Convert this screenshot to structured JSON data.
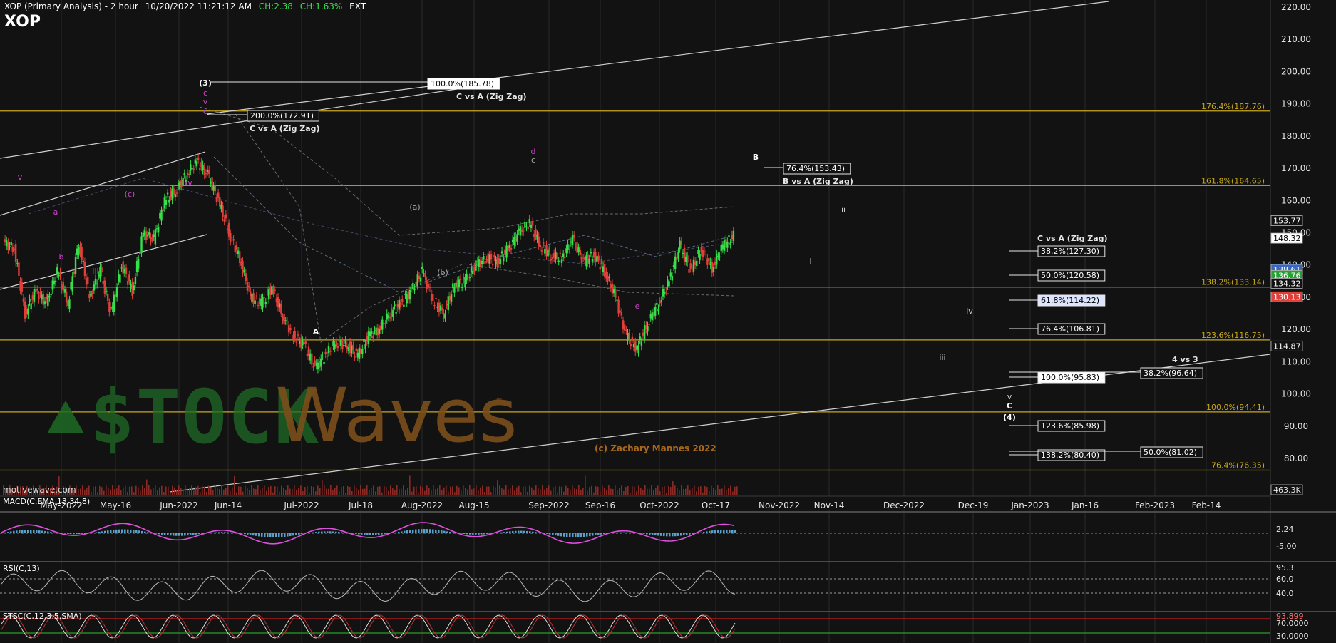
{
  "header": {
    "title": "XOP (Primary Analysis) - 2 hour",
    "datetime": "10/20/2022 11:21:12 AM",
    "ch1": "CH:2.38",
    "ch2": "CH:1.63%",
    "session": "EXT",
    "symbol": "XOP"
  },
  "watermark": {
    "site": "motivewave.com",
    "credit": "(c) Zachary Mannes 2022",
    "logo_a": "$TOCK",
    "logo_b": "Waves",
    "tm": "™"
  },
  "colors": {
    "bg": "#121212",
    "up": "#35e04a",
    "down": "#e0403a",
    "fib": "#c8a81a",
    "wave": "#cc44cc",
    "macd_line": "#e050e0",
    "macd_hist": "#5aa0c8"
  },
  "chart_data": {
    "type": "line",
    "price_axis": {
      "ylim": [
        72,
        222
      ],
      "ticks": [
        80,
        90,
        100,
        110,
        120,
        130,
        140,
        150,
        160,
        170,
        180,
        190,
        200,
        210,
        220
      ]
    },
    "time_axis": {
      "labels": [
        "May-2022",
        "May-16",
        "Jun-2022",
        "Jun-14",
        "Jul-2022",
        "Jul-18",
        "Aug-2022",
        "Aug-15",
        "Sep-2022",
        "Sep-16",
        "Oct-2022",
        "Oct-17",
        "Nov-2022",
        "Nov-14",
        "Dec-2022",
        "Dec-19",
        "Jan-2023",
        "Jan-16",
        "Feb-2023",
        "Feb-14"
      ]
    },
    "price_series": {
      "name": "XOP",
      "values": [
        147,
        145,
        125,
        132,
        128,
        138,
        128,
        147,
        130,
        138,
        125,
        140,
        132,
        150,
        148,
        160,
        163,
        168,
        172,
        168,
        160,
        150,
        142,
        130,
        128,
        133,
        124,
        118,
        115,
        108,
        112,
        116,
        115,
        112,
        118,
        120,
        125,
        128,
        132,
        138,
        129,
        125,
        134,
        135,
        140,
        142,
        141,
        145,
        150,
        153,
        146,
        143,
        142,
        148,
        141,
        143,
        138,
        130,
        118,
        114,
        122,
        128,
        135,
        146,
        138,
        145,
        139,
        146,
        149
      ]
    },
    "fib_lines": [
      {
        "price": 187.76,
        "label": "176.4%(187.76)"
      },
      {
        "price": 164.65,
        "label": "161.8%(164.65)"
      },
      {
        "price": 133.14,
        "label": "138.2%(133.14)"
      },
      {
        "price": 116.75,
        "label": "123.6%(116.75)"
      },
      {
        "price": 94.41,
        "label": "100.0%(94.41)"
      },
      {
        "price": 76.35,
        "label": "76.4%(76.35)"
      }
    ],
    "right_axis_tags": [
      {
        "price": 153.77,
        "label": "153.77",
        "bg": "#121212"
      },
      {
        "price": 148.32,
        "label": "148.32",
        "bg": "#ffffff"
      },
      {
        "price": 138.61,
        "label": "138.61",
        "bg": "#3a66c0"
      },
      {
        "price": 136.76,
        "label": "136.76",
        "bg": "#25a032"
      },
      {
        "price": 134.32,
        "label": "134.32",
        "bg": "#121212"
      },
      {
        "price": 130.13,
        "label": "130.13",
        "bg": "#e0403a"
      },
      {
        "price": 114.87,
        "label": "114.87",
        "bg": "#121212"
      }
    ],
    "volume_tag": "463.3K",
    "annotations": {
      "target_c_top": {
        "pct": "100.0%(185.78)",
        "text": "C vs A (Zig Zag)"
      },
      "target_c_mid": {
        "pct": "200.0%(172.91)",
        "text": "C vs A (Zig Zag)"
      },
      "target_b": {
        "pct": "76.4%(153.43)",
        "text": "B vs A (Zig Zag)"
      },
      "c_vs_a_title": "C vs A (Zig Zag)",
      "c_vs_a_levels": [
        "38.2%(127.30)",
        "50.0%(120.58)",
        "61.8%(114.22)",
        "76.4%(106.81)",
        "100.0%(95.83)",
        "123.6%(85.98)",
        "138.2%(80.40)"
      ],
      "four_vs_three_title": "4 vs 3",
      "four_vs_three_levels": [
        "38.2%(96.64)",
        "50.0%(81.02)"
      ]
    },
    "wave_labels": [
      "(3)",
      "c",
      "v",
      "c",
      "A",
      "B",
      "c",
      "(a)",
      "(b)",
      "(c)",
      "d",
      "e",
      "i",
      "ii",
      "iii",
      "iv",
      "v",
      "C",
      "(4)",
      "a",
      "b",
      "iii",
      "iv",
      "v"
    ],
    "macd": {
      "label": "MACD(C,EMA,13,34,8)",
      "ticks": [
        "2.24",
        "-5.00"
      ]
    },
    "rsi": {
      "label": "RSI(C,13)",
      "ticks": [
        "95.3",
        "60.0",
        "40.0"
      ]
    },
    "stoch": {
      "label": "STSC(C,12,3,5,SMA)",
      "ticks": [
        "93.899",
        "70.0000",
        "30.0000"
      ]
    }
  }
}
